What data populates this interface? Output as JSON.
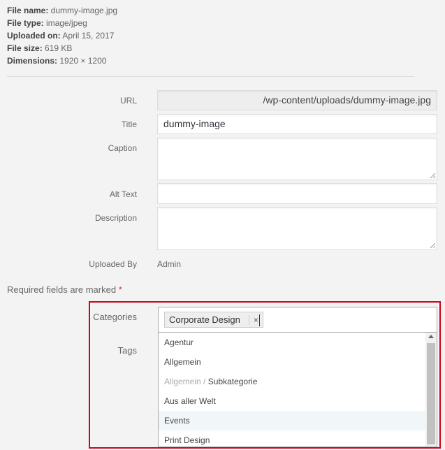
{
  "details": {
    "file_name_label": "File name:",
    "file_name": "dummy-image.jpg",
    "file_type_label": "File type:",
    "file_type": "image/jpeg",
    "uploaded_on_label": "Uploaded on:",
    "uploaded_on": "April 15, 2017",
    "file_size_label": "File size:",
    "file_size": "619 KB",
    "dimensions_label": "Dimensions:",
    "dimensions": "1920 × 1200"
  },
  "form": {
    "url_label": "URL",
    "url_value": "/wp-content/uploads/dummy-image.jpg",
    "title_label": "Title",
    "title_value": "dummy-image",
    "caption_label": "Caption",
    "caption_value": "",
    "alt_label": "Alt Text",
    "alt_value": "",
    "description_label": "Description",
    "description_value": "",
    "uploaded_by_label": "Uploaded By",
    "uploaded_by_value": "Admin"
  },
  "required_note": "Required fields are marked",
  "required_star": "*",
  "categories": {
    "label": "Categories",
    "selected": "Corporate Design",
    "remove_symbol": "×",
    "options": [
      {
        "parent": "",
        "label": "Agentur"
      },
      {
        "parent": "",
        "label": "Allgemein"
      },
      {
        "parent": "Allgemein /",
        "label": "Subkategorie"
      },
      {
        "parent": "",
        "label": "Aus aller Welt"
      },
      {
        "parent": "",
        "label": "Events",
        "hover": true
      },
      {
        "parent": "",
        "label": "Print Design"
      }
    ]
  },
  "tags": {
    "label": "Tags"
  },
  "icons": {
    "scroll_up": "scroll-up-arrow-icon",
    "resize": "resize-grip-icon"
  }
}
